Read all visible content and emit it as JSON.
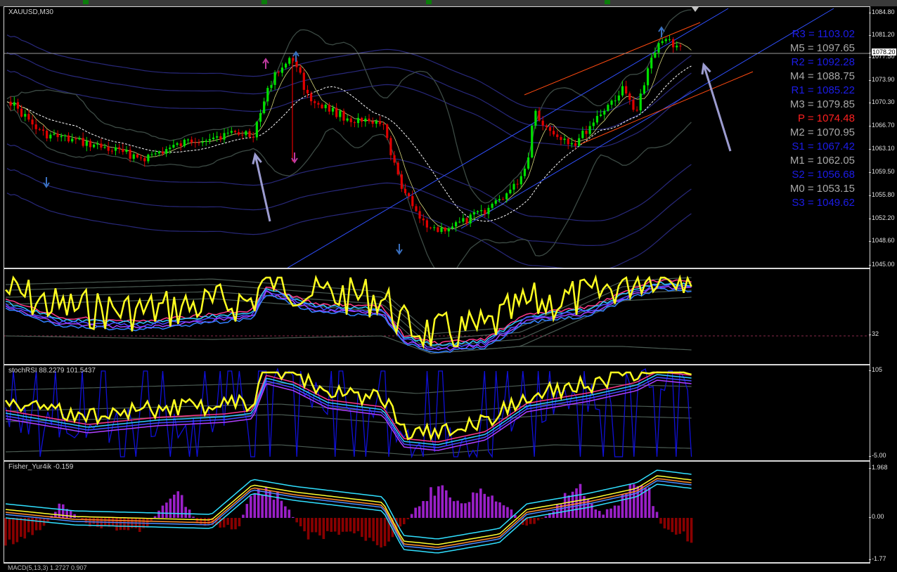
{
  "window": {
    "symbol_label": "XAUUSD,M30",
    "stoch_label": "stochRSI 88.2279 101.5437",
    "fisher_label": "Fisher_Yur4ik -0.159",
    "macd_label": "MACD(5,13,3) 1.2727 0.907"
  },
  "price_scale": {
    "ticks": [
      "1084.80",
      "1081.20",
      "1077.50",
      "1073.90",
      "1070.30",
      "1066.70",
      "1063.10",
      "1059.50",
      "1055.80",
      "1052.20",
      "1048.60",
      "1045.00"
    ],
    "current_price": "1078.20"
  },
  "pane2_scale": {
    "ticks": [
      "32"
    ]
  },
  "pane3_scale": {
    "ticks": [
      "105",
      "-5.00"
    ]
  },
  "pane4_scale": {
    "ticks": [
      "1.968",
      "0.00",
      "-1.77"
    ]
  },
  "pivots": [
    {
      "text": "R3 = 1103.02",
      "color": "#1c1ce8"
    },
    {
      "text": "M5 = 1097.65",
      "color": "#a8a8a8"
    },
    {
      "text": "R2 = 1092.28",
      "color": "#1c1ce8"
    },
    {
      "text": "M4 = 1088.75",
      "color": "#a8a8a8"
    },
    {
      "text": "R1 = 1085.22",
      "color": "#1c1ce8"
    },
    {
      "text": "M3 = 1079.85",
      "color": "#a8a8a8"
    },
    {
      "text": "P  = 1074.48",
      "color": "#ff2020"
    },
    {
      "text": "M2 = 1070.95",
      "color": "#a8a8a8"
    },
    {
      "text": "S1 = 1067.42",
      "color": "#1c1ce8"
    },
    {
      "text": "M1 = 1062.05",
      "color": "#a8a8a8"
    },
    {
      "text": "S2 = 1056.68",
      "color": "#1c1ce8"
    },
    {
      "text": "M0 = 1053.15",
      "color": "#a8a8a8"
    },
    {
      "text": "S3 = 1049.62",
      "color": "#1c1ce8"
    }
  ],
  "colors": {
    "bull_candle": "#00e000",
    "bear_candle": "#e00000",
    "bollinger": "#3c4a44",
    "envelope": "#28287a",
    "channel_blue": "#3050ff",
    "channel_red": "#ff4a10",
    "annotation_arrow": "#9c9cd0",
    "rsi_yellow": "#ffff20",
    "stoch_blue": "#1010d8",
    "fisher_hist_up": "#9a20c8",
    "fisher_hist_down": "#8a0000"
  }
}
